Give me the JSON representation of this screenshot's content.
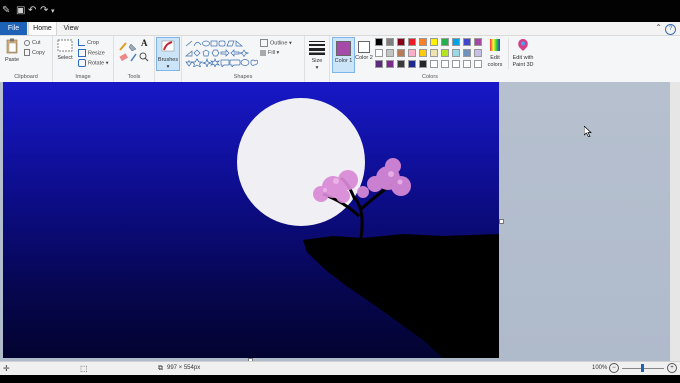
{
  "tabs": {
    "file": "File",
    "home": "Home",
    "view": "View"
  },
  "ribbon": {
    "clipboard": {
      "paste": "Paste",
      "cut": "Cut",
      "copy": "Copy",
      "label": "Clipboard"
    },
    "image": {
      "select": "Select",
      "crop": "Crop",
      "resize": "Resize",
      "rotate": "Rotate",
      "label": "Image"
    },
    "tools": {
      "label": "Tools",
      "text_tool": "A"
    },
    "brushes": "Brushes",
    "shapes": {
      "outline": "Outline",
      "fill": "Fill",
      "label": "Shapes"
    },
    "size": "Size",
    "color1": "Color 1",
    "color2": "Color 2",
    "colors_label": "Colors",
    "edit_colors": "Edit colors",
    "edit_paint3d": "Edit with Paint 3D"
  },
  "palette": [
    "#000000",
    "#7f7f7f",
    "#880015",
    "#ed1c24",
    "#ff7f27",
    "#fff200",
    "#22b14c",
    "#00a2e8",
    "#3f48cc",
    "#a349a4",
    "#ffffff",
    "#c3c3c3",
    "#b97a57",
    "#ffaec9",
    "#ffc90e",
    "#efe4b0",
    "#b5e61d",
    "#99d9ea",
    "#7092be",
    "#c8bfe7",
    "#5e2a7e",
    "#7c2a8c",
    "#3a3a3a",
    "#1b2a8c",
    "#262626",
    "#ffffff",
    "#ffffff",
    "#ffffff",
    "#ffffff",
    "#ffffff"
  ],
  "colors": {
    "color1": "#a54aa8",
    "color2": "#ffffff",
    "sky_top": "#1818c8",
    "moon": "#f0f0f4",
    "blossom": "#d98ad6"
  },
  "status": {
    "dimensions": "997 × 554px",
    "zoom": "100%"
  }
}
